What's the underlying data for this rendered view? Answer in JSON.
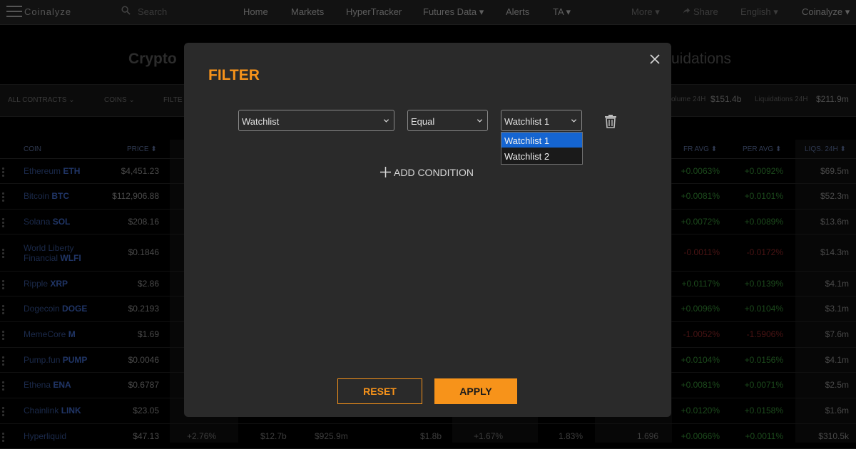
{
  "nav": {
    "logo": "Coinalyze",
    "search_placeholder": "Search",
    "items": [
      "Home",
      "Markets",
      "HyperTracker",
      "Futures Data ▾",
      "Alerts",
      "TA ▾"
    ],
    "right_items": [
      "More ▾",
      "Share",
      "English ▾",
      "Coinalyze ▾"
    ]
  },
  "page": {
    "title_left": "Crypto",
    "title_right": "uidations"
  },
  "filterbar": {
    "items": [
      "ALL CONTRACTS",
      "COINS",
      "FILTE"
    ],
    "volume_label": "olume 24H",
    "volume_value": "$151.4b",
    "liquidations_label": "Liquidations 24H",
    "liquidations_value": "$211.9m"
  },
  "table": {
    "headers": {
      "coin": "COIN",
      "price": "PRICE",
      "fr_avg": "FR AVG",
      "per_avg": "PER AVG",
      "liqs": "LIQS. 24H"
    },
    "rows": [
      {
        "name": "Ethereum",
        "symbol": "ETH",
        "price": "$4,451.23",
        "fr": "+0.0063%",
        "per": "+0.0092%",
        "liq": "$69.5m"
      },
      {
        "name": "Bitcoin",
        "symbol": "BTC",
        "price": "$112,906.88",
        "fr": "+0.0081%",
        "per": "+0.0101%",
        "liq": "$52.3m"
      },
      {
        "name": "Solana",
        "symbol": "SOL",
        "price": "$208.16",
        "fr": "+0.0072%",
        "per": "+0.0089%",
        "liq": "$13.6m"
      },
      {
        "name": "World Liberty Financial",
        "symbol": "WLFI",
        "price": "$0.1846",
        "fr": "-0.0011%",
        "per": "-0.0172%",
        "liq": "$14.3m"
      },
      {
        "name": "Ripple",
        "symbol": "XRP",
        "price": "$2.86",
        "fr": "+0.0117%",
        "per": "+0.0139%",
        "liq": "$4.1m"
      },
      {
        "name": "Dogecoin",
        "symbol": "DOGE",
        "price": "$0.2193",
        "fr": "+0.0096%",
        "per": "+0.0104%",
        "liq": "$3.1m"
      },
      {
        "name": "MemeCore",
        "symbol": "M",
        "price": "$1.69",
        "fr": "-1.0052%",
        "per": "-1.5906%",
        "liq": "$7.6m"
      },
      {
        "name": "Pump.fun",
        "symbol": "PUMP",
        "price": "$0.0046",
        "fr": "+0.0104%",
        "per": "+0.0156%",
        "liq": "$4.1m"
      },
      {
        "name": "Ethena",
        "symbol": "ENA",
        "price": "$0.6787",
        "fr": "+0.0081%",
        "per": "+0.0071%",
        "liq": "$2.5m"
      },
      {
        "name": "Chainlink",
        "symbol": "LINK",
        "price": "$23.05",
        "fr": "+0.0120%",
        "per": "+0.0158%",
        "liq": "$1.6m"
      },
      {
        "name": "Hyperliquid",
        "symbol": "",
        "price": "$47.13",
        "fr": "+0.0066%",
        "per": "+0.0011%",
        "liq": "$310.5k"
      }
    ],
    "last_row_extra": [
      "+2.76%",
      "$12.7b",
      "$925.9m",
      "$1.8b",
      "+1.67%",
      "1.83%",
      "1.696"
    ]
  },
  "modal": {
    "title": "FILTER",
    "field_select": "Watchlist",
    "operator_select": "Equal",
    "value_select": "Watchlist 1",
    "dropdown_options": [
      "Watchlist 1",
      "Watchlist 2"
    ],
    "selected_option": "Watchlist 1",
    "add_condition": "ADD CONDITION",
    "reset_label": "RESET",
    "apply_label": "APPLY"
  },
  "colors": {
    "accent": "#f7931a",
    "modal_bg": "#2a2a2a",
    "dropdown_selected": "#1565d1"
  }
}
